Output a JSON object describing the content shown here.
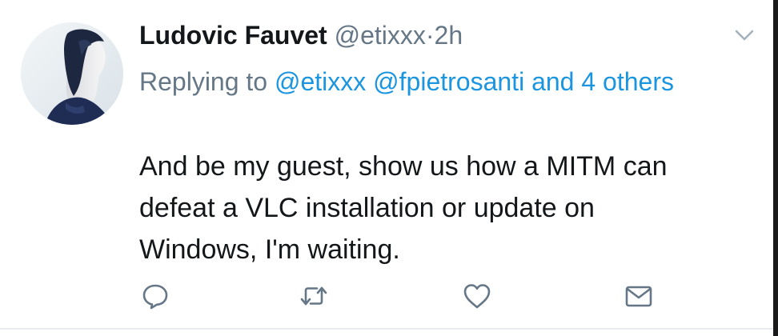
{
  "tweet": {
    "author_name": "Ludovic Fauvet",
    "author_handle": "@etixxx",
    "separator": "·",
    "time": "2h",
    "replying_prefix": "Replying to",
    "mentions": [
      "@etixxx",
      "@fpietrosanti"
    ],
    "others_link": "and 4 others",
    "text_lines": [
      "And be my guest, show us how a MITM can",
      "defeat a VLC installation or update on",
      "Windows, I'm waiting."
    ],
    "icons": {
      "menu": "chevron-down-icon",
      "reply": "reply-icon",
      "retweet": "retweet-icon",
      "like": "heart-icon",
      "share": "mail-icon"
    }
  },
  "colors": {
    "link": "#1b95e0",
    "secondary_text": "#657786",
    "primary_text": "#14171a"
  }
}
